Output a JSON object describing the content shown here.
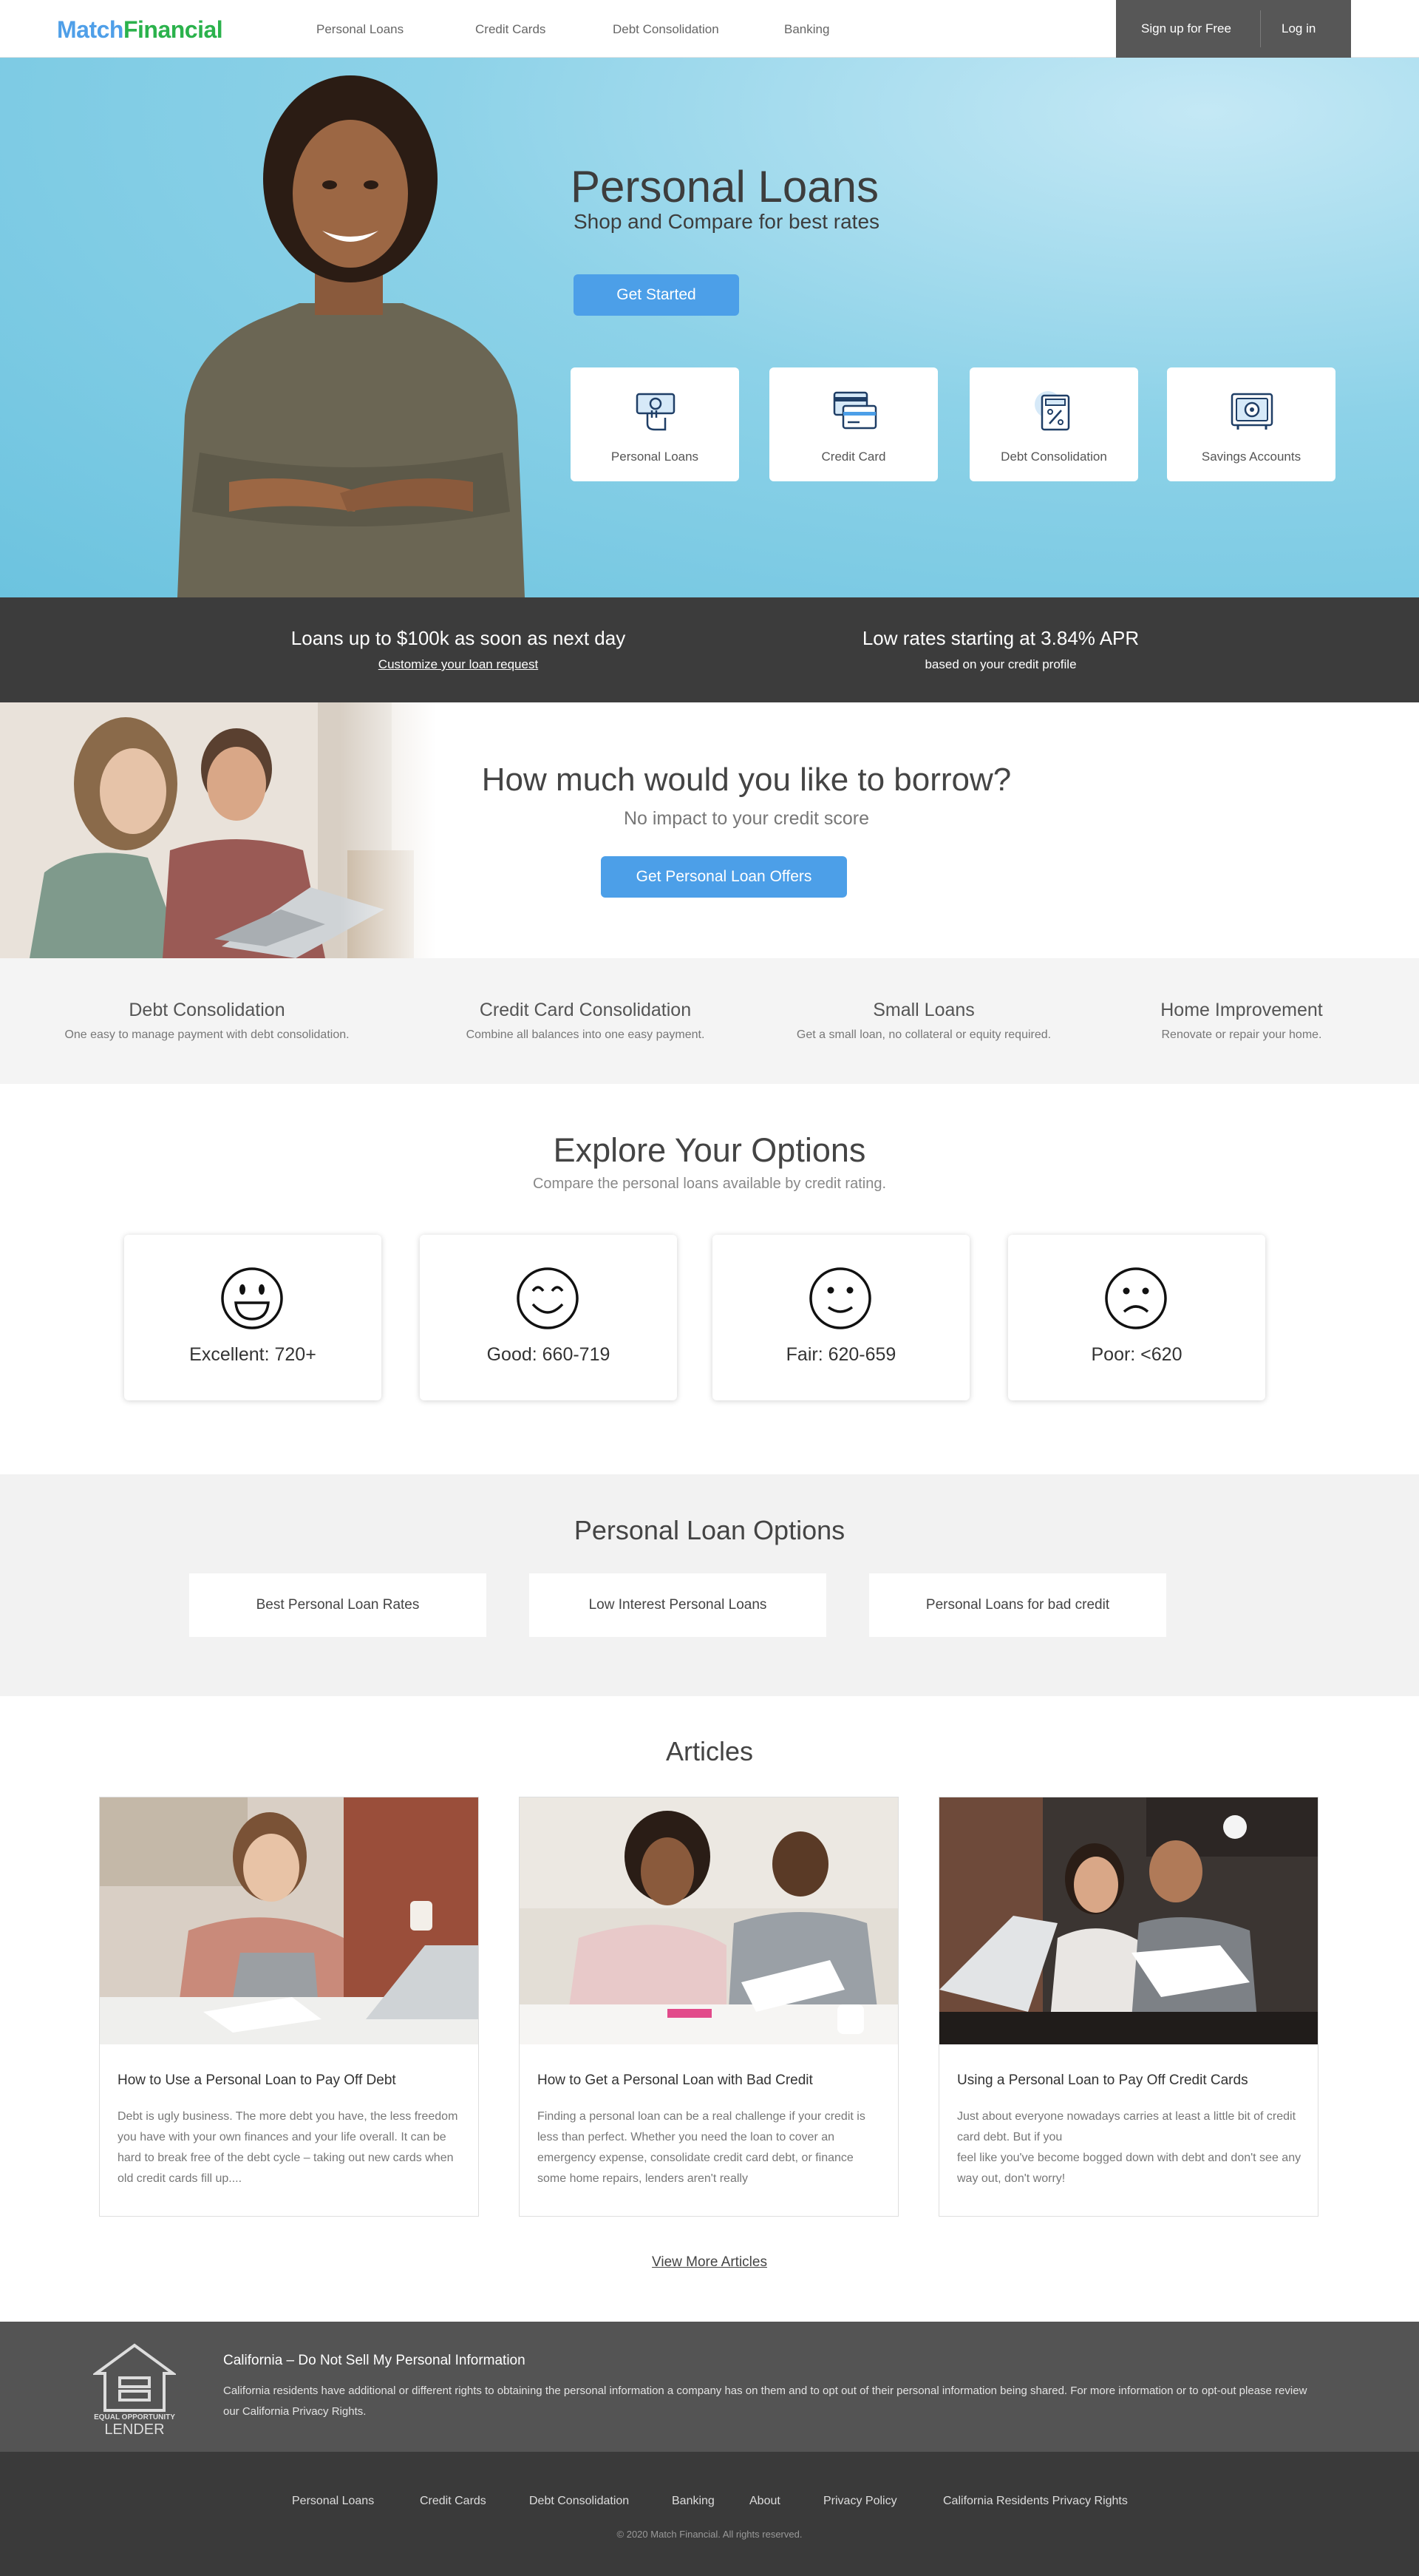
{
  "brand": {
    "part1": "Match",
    "part2": "Financial",
    "color1": "#4f9fe8",
    "color2": "#2bb24c"
  },
  "nav": {
    "items": [
      "Personal Loans",
      "Credit Cards",
      "Debt Consolidation",
      "Banking"
    ]
  },
  "auth": {
    "signup": "Sign up for Free",
    "login": "Log in"
  },
  "hero": {
    "title": "Personal Loans",
    "subtitle": "Shop and Compare for best rates",
    "cta": "Get Started",
    "tiles": [
      {
        "label": "Personal Loans",
        "icon": "hand-cash-icon"
      },
      {
        "label": "Credit Card",
        "icon": "credit-card-icon"
      },
      {
        "label": "Debt Consolidation",
        "icon": "calculator-percent-icon"
      },
      {
        "label": "Savings Accounts",
        "icon": "safe-icon"
      }
    ]
  },
  "promo": {
    "left_title": "Loans up to $100k as soon as next day",
    "left_link": "Customize your loan request",
    "right_title": "Low rates starting at 3.84% APR",
    "right_sub": "based on your credit profile"
  },
  "borrow": {
    "title": "How much would you like to borrow?",
    "subtitle": "No impact to your credit score",
    "cta": "Get Personal Loan Offers"
  },
  "categories": [
    {
      "title": "Debt Consolidation",
      "desc": "One easy to manage payment with debt consolidation."
    },
    {
      "title": "Credit Card Consolidation",
      "desc": "Combine all balances into one easy payment."
    },
    {
      "title": "Small Loans",
      "desc": "Get a small loan, no collateral or equity required."
    },
    {
      "title": "Home Improvement",
      "desc": "Renovate or repair your home."
    }
  ],
  "explore": {
    "title": "Explore Your Options",
    "subtitle": "Compare the personal loans available by credit rating.",
    "cards": [
      {
        "label": "Excellent: 720+",
        "icon": "grin-face-icon"
      },
      {
        "label": "Good: 660-719",
        "icon": "smile-face-icon"
      },
      {
        "label": "Fair: 620-659",
        "icon": "slight-smile-face-icon"
      },
      {
        "label": "Poor: <620",
        "icon": "frown-face-icon"
      }
    ]
  },
  "loan_options": {
    "title": "Personal Loan Options",
    "items": [
      "Best Personal Loan Rates",
      "Low Interest Personal Loans",
      "Personal Loans for bad credit"
    ]
  },
  "articles": {
    "title": "Articles",
    "items": [
      {
        "title": "How to Use a Personal Loan to Pay Off Debt",
        "body": "Debt is ugly business. The more debt you have, the less freedom you have with your own finances and your life overall. It can be hard to break free of the debt cycle – taking out new cards when old credit cards fill up...."
      },
      {
        "title": "How to Get a Personal Loan with Bad Credit",
        "body": "Finding a personal loan can be a real challenge if your credit is less than perfect. Whether you need the loan to cover an emergency expense, consolidate credit card debt, or finance some home repairs, lenders aren't really"
      },
      {
        "title": "Using a Personal Loan to Pay Off Credit Cards",
        "body": "Just about everyone nowadays carries at least a little bit of credit card debt. But if you\nfeel like you've become bogged down with debt and don't see any way out, don't worry!"
      }
    ],
    "more": "View More Articles"
  },
  "california": {
    "badge_line1": "EQUAL OPPORTUNITY",
    "badge_line2": "LENDER",
    "title": "California – Do Not Sell My Personal Information",
    "text": "California residents have additional or different rights to obtaining the personal information a company has on them and to opt out of their personal information being shared. For more information or to opt-out please review our California Privacy Rights."
  },
  "footer": {
    "links": [
      "Personal Loans",
      "Credit Cards",
      "Debt Consolidation",
      "Banking",
      "About",
      "Privacy Policy",
      "California Residents Privacy Rights"
    ],
    "copyright": "© 2020 Match Financial. All rights reserved."
  }
}
